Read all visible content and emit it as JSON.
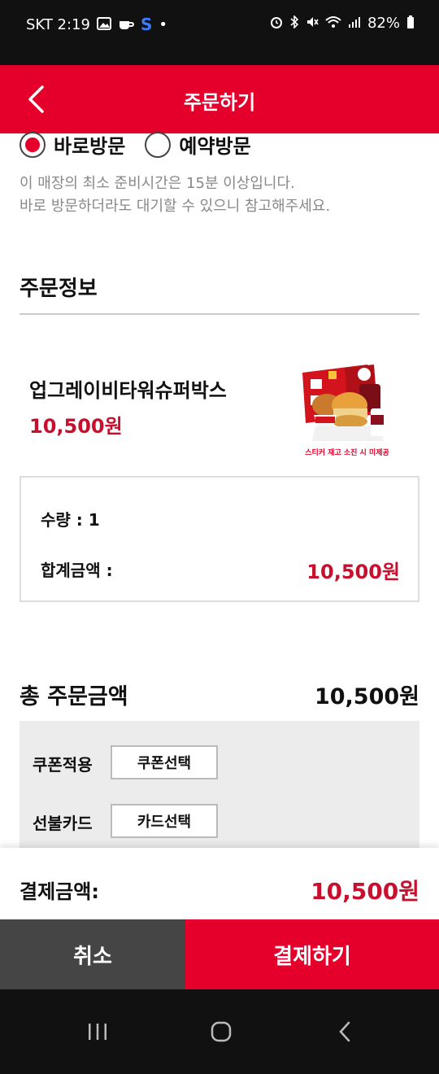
{
  "status_bar": {
    "carrier_time": "SKT 2:19",
    "app_s": "S",
    "dot": "•",
    "battery": "82%"
  },
  "header": {
    "title": "주문하기"
  },
  "visit_options": {
    "direct": "바로방문",
    "reserve": "예약방문",
    "selected": "바로방문"
  },
  "notice": {
    "line1": "이 매장의 최소 준비시간은 15분 이상입니다.",
    "line2": "바로 방문하더라도 대기할 수 있으니 참고해주세요."
  },
  "order_info": {
    "section_title": "주문정보",
    "product_name": "업그레이비타워슈퍼박스",
    "product_price": "10,500원",
    "image_caption": "스티커 재고 소진 시 미제공",
    "quantity": "수량 : 1",
    "sum_label": "합계금액 :",
    "sum_value": "10,500원"
  },
  "total": {
    "label": "총 주문금액",
    "value": "10,500원"
  },
  "payment_options": {
    "coupon_label": "쿠폰적용",
    "coupon_button": "쿠폰선택",
    "giftcard_label": "선불카드",
    "giftcard_button": "카드선택"
  },
  "payment": {
    "label": "결제금액:",
    "value": "10,500원"
  },
  "actions": {
    "cancel": "취소",
    "pay": "결제하기"
  },
  "colors": {
    "brand_red": "#e4002b",
    "price_red": "#c8102e",
    "dark_button": "#454545"
  },
  "icons": [
    "back-arrow-icon",
    "gallery-icon",
    "coffee-icon",
    "alarm-icon",
    "bluetooth-icon",
    "mute-icon",
    "wifi-icon",
    "signal-icon",
    "battery-icon",
    "recent-apps-icon",
    "home-icon",
    "nav-back-icon"
  ]
}
